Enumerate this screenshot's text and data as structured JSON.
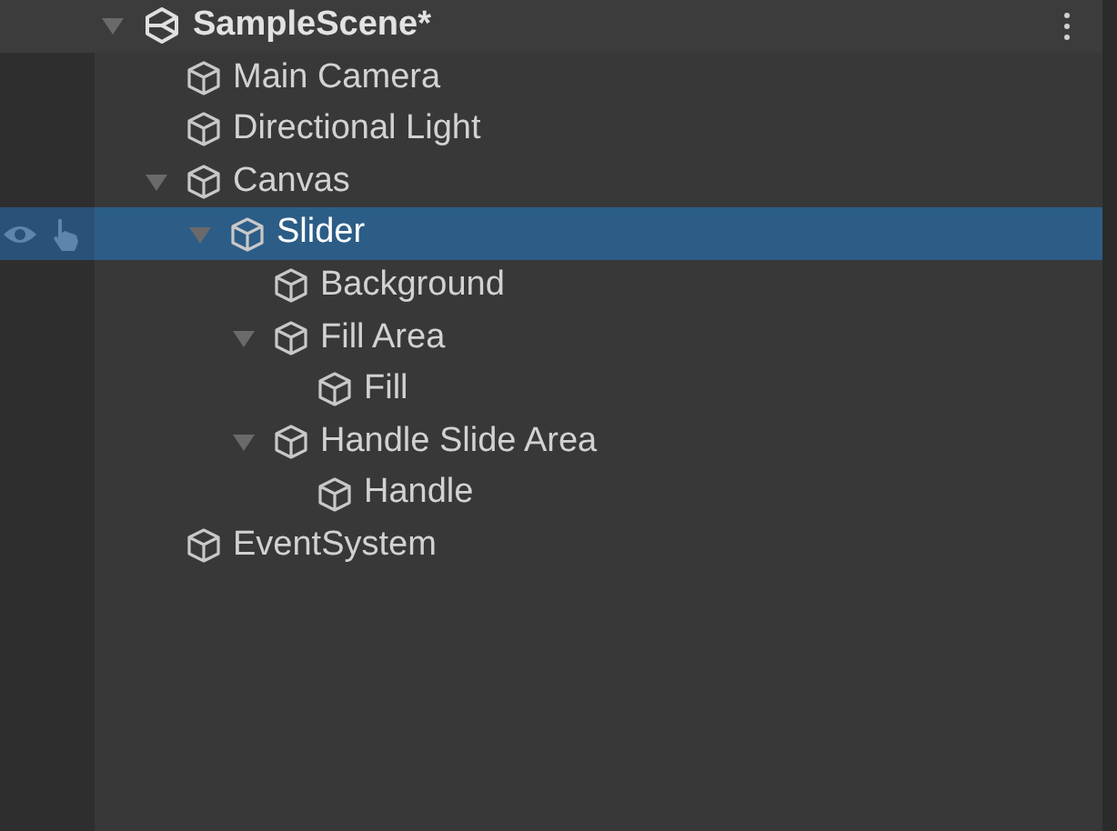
{
  "scene": {
    "title": "SampleScene*",
    "expanded": true,
    "selected": false,
    "children": [
      {
        "label": "Main Camera",
        "selected": false
      },
      {
        "label": "Directional Light",
        "selected": false
      },
      {
        "label": "Canvas",
        "selected": false,
        "expanded": true,
        "children": [
          {
            "label": "Slider",
            "selected": true,
            "expanded": true,
            "children": [
              {
                "label": "Background",
                "selected": false
              },
              {
                "label": "Fill Area",
                "selected": false,
                "expanded": true,
                "children": [
                  {
                    "label": "Fill",
                    "selected": false
                  }
                ]
              },
              {
                "label": "Handle Slide Area",
                "selected": false,
                "expanded": true,
                "children": [
                  {
                    "label": "Handle",
                    "selected": false
                  }
                ]
              }
            ]
          }
        ]
      },
      {
        "label": "EventSystem",
        "selected": false
      }
    ]
  }
}
